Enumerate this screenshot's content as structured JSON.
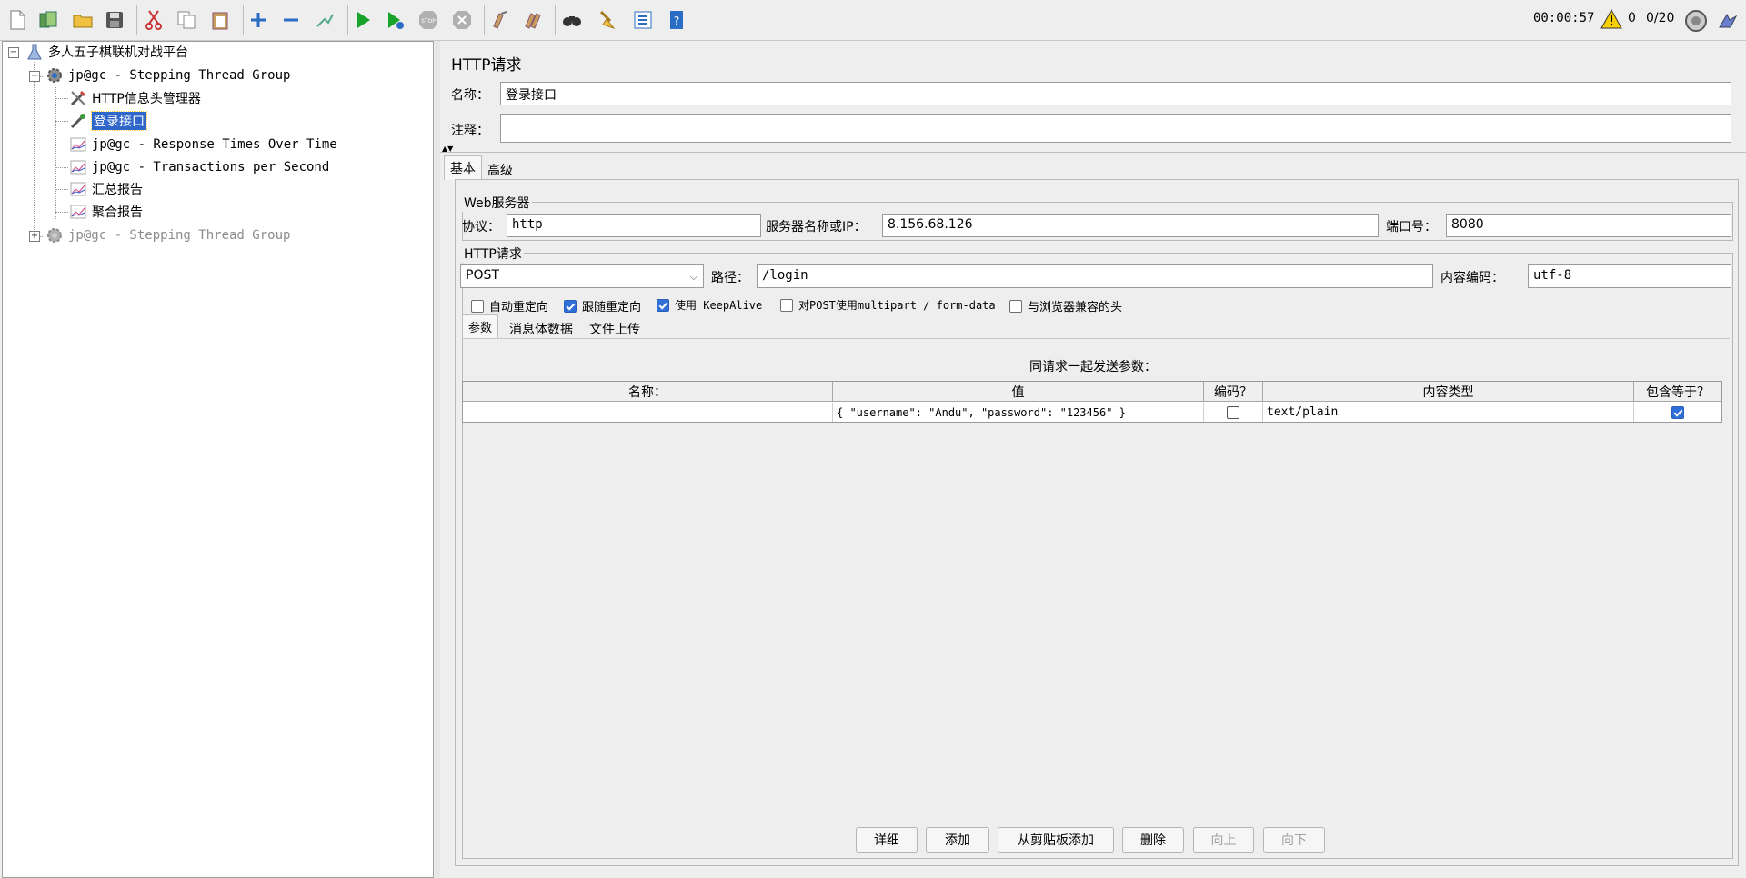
{
  "toolbar": {
    "icons": [
      "new-icon",
      "templates-icon",
      "open-icon",
      "save-icon",
      "cut-icon",
      "copy-icon",
      "paste-icon",
      "expand-icon",
      "collapse-icon",
      "toggle-icon",
      "start-icon",
      "start-no-pause-icon",
      "stop-icon",
      "shutdown-icon",
      "clear-icon",
      "clear-all-icon",
      "search-icon",
      "reset-search-icon",
      "function-helper-icon",
      "help-icon"
    ],
    "timer": "00:00:57",
    "warnings": "0",
    "threads": "0/20"
  },
  "tree": {
    "root": "多人五子棋联机对战平台",
    "group1": "jp@gc - Stepping Thread Group",
    "children": [
      {
        "label": "HTTP信息头管理器",
        "icon": "wrench-icon"
      },
      {
        "label": "登录接口",
        "icon": "sampler-icon",
        "selected": true
      },
      {
        "label": "jp@gc - Response Times Over Time",
        "icon": "graph-icon"
      },
      {
        "label": "jp@gc - Transactions per Second",
        "icon": "graph-icon"
      },
      {
        "label": "汇总报告",
        "icon": "graph-icon"
      },
      {
        "label": "聚合报告",
        "icon": "graph-icon"
      }
    ],
    "group2": "jp@gc - Stepping Thread Group"
  },
  "panel": {
    "title": "HTTP请求",
    "name_label": "名称：",
    "name_value": "登录接口",
    "comment_label": "注释：",
    "comment_value": "",
    "tabs": [
      "基本",
      "高级"
    ],
    "web_server": {
      "title": "Web服务器",
      "protocol_label": "协议：",
      "protocol_value": "http",
      "server_label": "服务器名称或IP：",
      "server_value": "8.156.68.126",
      "port_label": "端口号：",
      "port_value": "8080"
    },
    "http_request": {
      "title": "HTTP请求",
      "method": "POST",
      "path_label": "路径：",
      "path_value": "/login",
      "encoding_label": "内容编码：",
      "encoding_value": "utf-8",
      "options": [
        {
          "label": "自动重定向",
          "checked": false
        },
        {
          "label": "跟随重定向",
          "checked": true
        },
        {
          "label": "使用 KeepAlive",
          "checked": true
        },
        {
          "label": "对POST使用multipart / form-data",
          "checked": false
        },
        {
          "label": "与浏览器兼容的头",
          "checked": false
        }
      ],
      "subtabs": [
        "参数",
        "消息体数据",
        "文件上传"
      ],
      "params_caption": "同请求一起发送参数：",
      "columns": [
        "名称：",
        "值",
        "编码？",
        "内容类型",
        "包含等于？"
      ],
      "rows": [
        {
          "name": "",
          "value": "{    \"username\": \"Andu\",    \"password\": \"123456\" }",
          "encode": false,
          "content_type": "text/plain",
          "include_equals": true
        }
      ]
    },
    "buttons": [
      {
        "label": "详细",
        "enabled": true
      },
      {
        "label": "添加",
        "enabled": true
      },
      {
        "label": "从剪贴板添加",
        "enabled": true
      },
      {
        "label": "删除",
        "enabled": true
      },
      {
        "label": "向上",
        "enabled": false
      },
      {
        "label": "向下",
        "enabled": false
      }
    ]
  }
}
